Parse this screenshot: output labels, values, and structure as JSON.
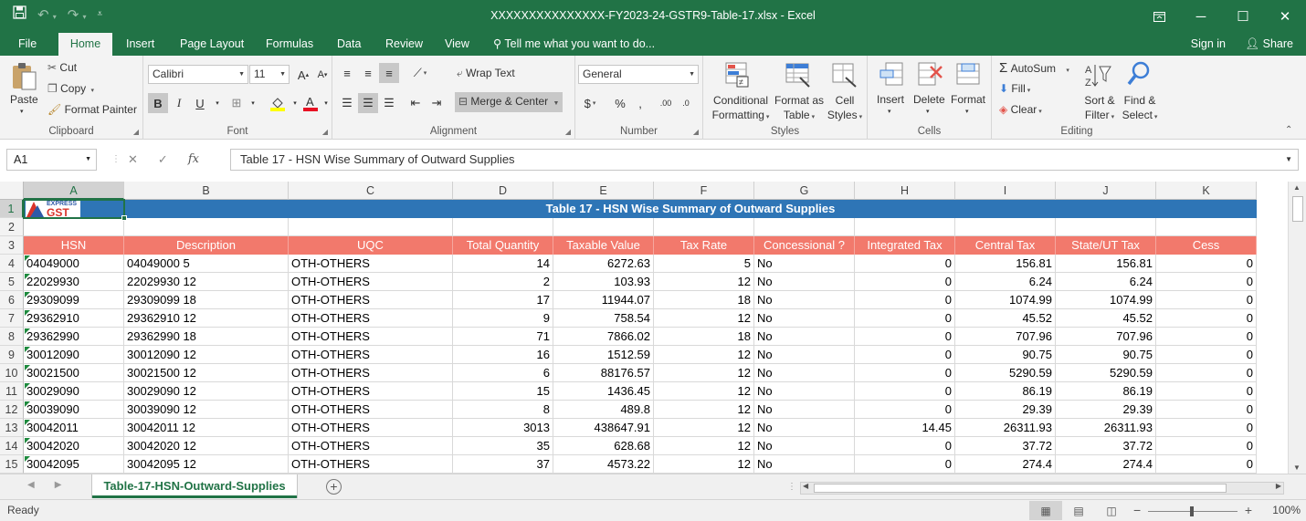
{
  "window": {
    "title": "XXXXXXXXXXXXXXX-FY2023-24-GSTR9-Table-17.xlsx  -  Excel"
  },
  "ribbon_tabs": {
    "file": "File",
    "home": "Home",
    "insert": "Insert",
    "page_layout": "Page Layout",
    "formulas": "Formulas",
    "data": "Data",
    "review": "Review",
    "view": "View",
    "tell_me": "Tell me what you want to do...",
    "sign_in": "Sign in",
    "share": "Share"
  },
  "ribbon": {
    "clipboard": {
      "label": "Clipboard",
      "paste": "Paste",
      "cut": "Cut",
      "copy": "Copy",
      "format_painter": "Format Painter"
    },
    "font": {
      "label": "Font",
      "font_name": "Calibri",
      "font_size": "11"
    },
    "alignment": {
      "label": "Alignment",
      "wrap_text": "Wrap Text",
      "merge_center": "Merge & Center"
    },
    "number": {
      "label": "Number",
      "format": "General"
    },
    "styles": {
      "label": "Styles",
      "conditional_1": "Conditional",
      "conditional_2": "Formatting",
      "format_table_1": "Format as",
      "format_table_2": "Table",
      "cell_styles_1": "Cell",
      "cell_styles_2": "Styles"
    },
    "cells": {
      "label": "Cells",
      "insert": "Insert",
      "delete": "Delete",
      "format": "Format"
    },
    "editing": {
      "label": "Editing",
      "autosum": "AutoSum",
      "fill": "Fill",
      "clear": "Clear",
      "sort_1": "Sort &",
      "sort_2": "Filter",
      "find_1": "Find &",
      "find_2": "Select"
    }
  },
  "formula_bar": {
    "name_box": "A1",
    "formula": "Table 17 - HSN Wise Summary of Outward Supplies"
  },
  "sheet": {
    "columns": [
      "A",
      "B",
      "C",
      "D",
      "E",
      "F",
      "G",
      "H",
      "I",
      "J",
      "K"
    ],
    "row_numbers": [
      "1",
      "2",
      "3",
      "4",
      "5",
      "6",
      "7",
      "8",
      "9",
      "10",
      "11",
      "12",
      "13",
      "14",
      "15"
    ],
    "title": "Table 17 - HSN Wise Summary of Outward Supplies",
    "logo_top": "EXPRESS",
    "logo_bottom": "GST",
    "headers": [
      "HSN",
      "Description",
      "UQC",
      "Total Quantity",
      "Taxable Value",
      "Tax Rate",
      "Concessional ?",
      "Integrated Tax",
      "Central Tax",
      "State/UT Tax",
      "Cess"
    ],
    "rows": [
      [
        "04049000",
        "04049000 5",
        "OTH-OTHERS",
        "14",
        "6272.63",
        "5",
        "No",
        "0",
        "156.81",
        "156.81",
        "0"
      ],
      [
        "22029930",
        "22029930 12",
        "OTH-OTHERS",
        "2",
        "103.93",
        "12",
        "No",
        "0",
        "6.24",
        "6.24",
        "0"
      ],
      [
        "29309099",
        "29309099 18",
        "OTH-OTHERS",
        "17",
        "11944.07",
        "18",
        "No",
        "0",
        "1074.99",
        "1074.99",
        "0"
      ],
      [
        "29362910",
        "29362910 12",
        "OTH-OTHERS",
        "9",
        "758.54",
        "12",
        "No",
        "0",
        "45.52",
        "45.52",
        "0"
      ],
      [
        "29362990",
        "29362990 18",
        "OTH-OTHERS",
        "71",
        "7866.02",
        "18",
        "No",
        "0",
        "707.96",
        "707.96",
        "0"
      ],
      [
        "30012090",
        "30012090 12",
        "OTH-OTHERS",
        "16",
        "1512.59",
        "12",
        "No",
        "0",
        "90.75",
        "90.75",
        "0"
      ],
      [
        "30021500",
        "30021500 12",
        "OTH-OTHERS",
        "6",
        "88176.57",
        "12",
        "No",
        "0",
        "5290.59",
        "5290.59",
        "0"
      ],
      [
        "30029090",
        "30029090 12",
        "OTH-OTHERS",
        "15",
        "1436.45",
        "12",
        "No",
        "0",
        "86.19",
        "86.19",
        "0"
      ],
      [
        "30039090",
        "30039090 12",
        "OTH-OTHERS",
        "8",
        "489.8",
        "12",
        "No",
        "0",
        "29.39",
        "29.39",
        "0"
      ],
      [
        "30042011",
        "30042011 12",
        "OTH-OTHERS",
        "3013",
        "438647.91",
        "12",
        "No",
        "14.45",
        "26311.93",
        "26311.93",
        "0"
      ],
      [
        "30042020",
        "30042020 12",
        "OTH-OTHERS",
        "35",
        "628.68",
        "12",
        "No",
        "0",
        "37.72",
        "37.72",
        "0"
      ],
      [
        "30042095",
        "30042095 12",
        "OTH-OTHERS",
        "37",
        "4573.22",
        "12",
        "No",
        "0",
        "274.4",
        "274.4",
        "0"
      ]
    ]
  },
  "sheet_tabs": {
    "active": "Table-17-HSN-Outward-Supplies"
  },
  "status": {
    "ready": "Ready",
    "zoom": "100%"
  },
  "colors": {
    "excel_green": "#217346",
    "title_band": "#2e75b6",
    "header_salmon": "#f2796c"
  }
}
